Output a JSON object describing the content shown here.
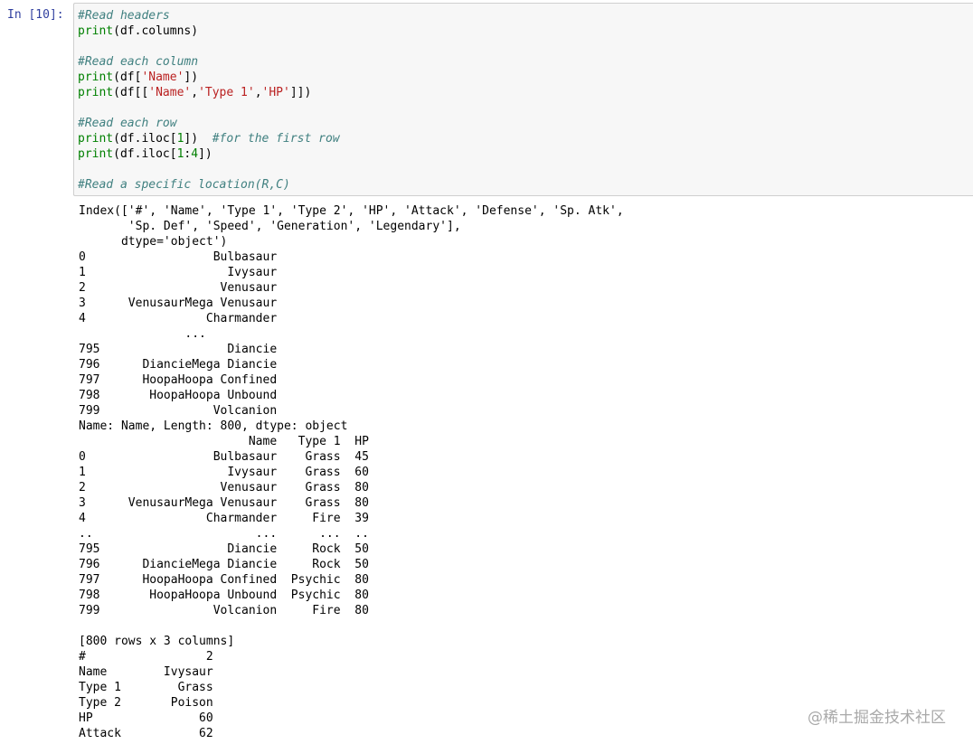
{
  "cell": {
    "prompt": "In [10]:",
    "code": {
      "l1": "#Read headers",
      "l2_fn": "print",
      "l2_rest": "(df.columns)",
      "l4": "#Read each column",
      "l5_fn": "print",
      "l5_a": "(df[",
      "l5_s1": "'Name'",
      "l5_b": "])",
      "l6_fn": "print",
      "l6_a": "(df[[",
      "l6_s1": "'Name'",
      "l6_c1": ",",
      "l6_s2": "'Type 1'",
      "l6_c2": ",",
      "l6_s3": "'HP'",
      "l6_b": "]])",
      "l8": "#Read each row",
      "l9_fn": "print",
      "l9_a": "(df.iloc[",
      "l9_n": "1",
      "l9_b": "])  ",
      "l9_comment": "#for the first row",
      "l10_fn": "print",
      "l10_a": "(df.iloc[",
      "l10_n1": "1",
      "l10_colon": ":",
      "l10_n2": "4",
      "l10_b": "])",
      "l12": "#Read a specific location(R,C)"
    }
  },
  "output": {
    "lines": [
      "Index(['#', 'Name', 'Type 1', 'Type 2', 'HP', 'Attack', 'Defense', 'Sp. Atk',",
      "       'Sp. Def', 'Speed', 'Generation', 'Legendary'],",
      "      dtype='object')",
      "0                  Bulbasaur",
      "1                    Ivysaur",
      "2                   Venusaur",
      "3      VenusaurMega Venusaur",
      "4                 Charmander",
      "               ...",
      "795                  Diancie",
      "796      DiancieMega Diancie",
      "797      HoopaHoopa Confined",
      "798       HoopaHoopa Unbound",
      "799                Volcanion",
      "Name: Name, Length: 800, dtype: object",
      "                        Name   Type 1  HP",
      "0                  Bulbasaur    Grass  45",
      "1                    Ivysaur    Grass  60",
      "2                   Venusaur    Grass  80",
      "3      VenusaurMega Venusaur    Grass  80",
      "4                 Charmander     Fire  39",
      "..                       ...      ...  ..",
      "795                  Diancie     Rock  50",
      "796      DiancieMega Diancie     Rock  50",
      "797      HoopaHoopa Confined  Psychic  80",
      "798       HoopaHoopa Unbound  Psychic  80",
      "799                Volcanion     Fire  80",
      "",
      "[800 rows x 3 columns]",
      "#                 2",
      "Name        Ivysaur",
      "Type 1        Grass",
      "Type 2       Poison",
      "HP               60",
      "Attack           62"
    ]
  },
  "watermark": "@稀土掘金技术社区"
}
